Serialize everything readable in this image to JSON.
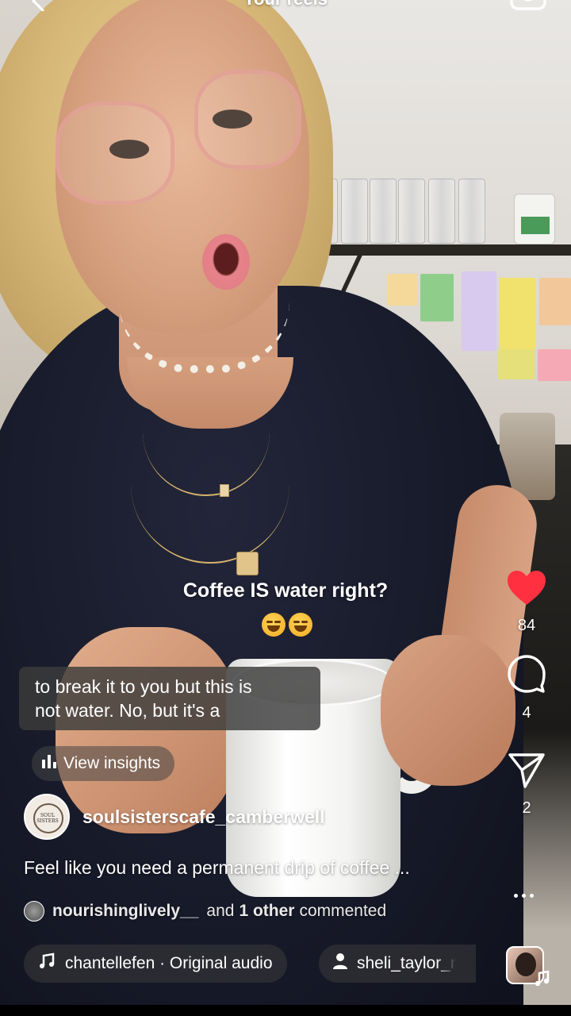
{
  "header": {
    "title": "Your reels"
  },
  "caption": {
    "main": "Coffee IS water right?",
    "emojis": [
      "😅",
      "😂"
    ]
  },
  "subtitle": {
    "line1": "to break it to you but this is",
    "line2": "not water. No, but it's a"
  },
  "insights": {
    "label": "View insights"
  },
  "account": {
    "username": "soulsisterscafe_camberwell"
  },
  "description": {
    "text": "Feel like you need a permanent drip of coffee ..."
  },
  "comments": {
    "user": "nourishinglively__",
    "and": "and",
    "other": "1 other",
    "suffix": "commented"
  },
  "audio": {
    "label": "chantellefen · Original audio"
  },
  "tag": {
    "label": "sheli_taylor_r"
  },
  "actions": {
    "likes": "84",
    "comments": "4",
    "shares": "2"
  },
  "colors": {
    "like_red": "#ff3040",
    "overlay_gray": "#3c3c3c"
  },
  "icons": {
    "back": "chevron-left-icon",
    "camera": "camera-icon",
    "like": "heart-icon",
    "comment": "comment-bubble-icon",
    "share": "paper-plane-icon",
    "more": "more-dots-icon",
    "insights": "bar-chart-icon",
    "audio": "music-note-icon",
    "tag": "person-icon"
  }
}
